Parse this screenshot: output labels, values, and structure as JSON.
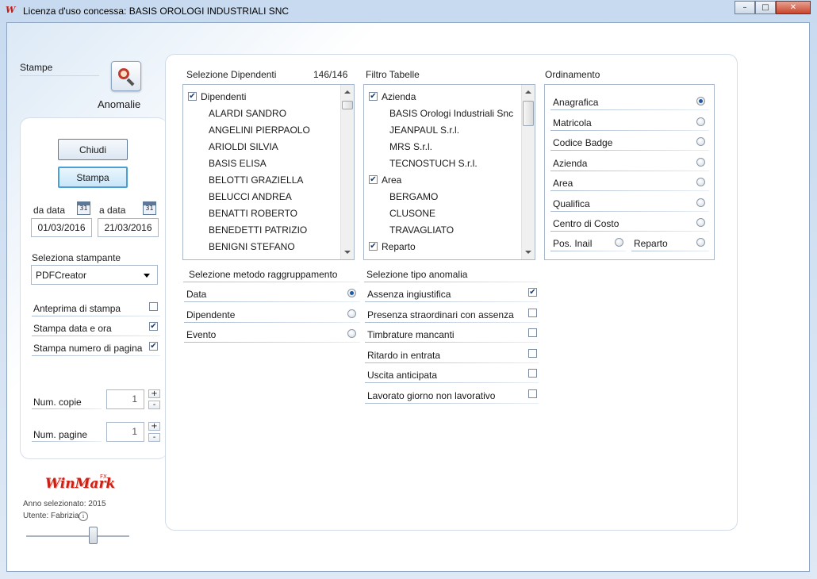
{
  "window": {
    "title": "Licenza d'uso concessa: BASIS OROLOGI INDUSTRIALI SNC",
    "logo_text": "W",
    "controls": {
      "minimize": "–",
      "maximize": "□",
      "close": "✕"
    }
  },
  "header": {
    "section_label": "Stampe",
    "report_label": "Anomalie",
    "report_icon": "magnifier-report-icon"
  },
  "left": {
    "close_label": "Chiudi",
    "print_label": "Stampa",
    "from_label": "da data",
    "to_label": "a data",
    "calendar_text": "31",
    "from_value": "01/03/2016",
    "to_value": "21/03/2016",
    "printer_label": "Seleziona stampante",
    "printer_value": "PDFCreator",
    "options": [
      {
        "label": "Anteprima di stampa",
        "checked": false
      },
      {
        "label": "Stampa data e ora",
        "checked": true
      },
      {
        "label": "Stampa numero di pagina",
        "checked": true
      }
    ],
    "copies_label": "Num. copie",
    "copies_value": "1",
    "pages_label": "Num. pagine",
    "pages_value": "1",
    "plus": "+",
    "minus": "-"
  },
  "footer": {
    "brand": "WinMark",
    "brand_sup": "FX",
    "year_text": "Anno selezionato: 2015",
    "user_text": "Utente: Fabrizia",
    "info_glyph": "i"
  },
  "dipendenti": {
    "title": "Selezione Dipendenti",
    "count": "146/146",
    "items": [
      {
        "label": "Dipendenti",
        "checkbox": true,
        "checked": true
      },
      {
        "label": "ALARDI SANDRO"
      },
      {
        "label": "ANGELINI PIERPAOLO"
      },
      {
        "label": "ARIOLDI SILVIA"
      },
      {
        "label": "BASIS ELISA"
      },
      {
        "label": "BELOTTI GRAZIELLA"
      },
      {
        "label": "BELUCCI ANDREA"
      },
      {
        "label": "BENATTI ROBERTO"
      },
      {
        "label": "BENEDETTI PATRIZIO"
      },
      {
        "label": "BENIGNI STEFANO"
      }
    ]
  },
  "filtro": {
    "title": "Filtro Tabelle",
    "items": [
      {
        "label": "Azienda",
        "checkbox": true,
        "checked": true
      },
      {
        "label": "BASIS Orologi Industriali Snc"
      },
      {
        "label": "JEANPAUL S.r.l."
      },
      {
        "label": "MRS S.r.l."
      },
      {
        "label": "TECNOSTUCH S.r.l."
      },
      {
        "label": "Area",
        "checkbox": true,
        "checked": true
      },
      {
        "label": "BERGAMO"
      },
      {
        "label": "CLUSONE"
      },
      {
        "label": "TRAVAGLIATO"
      },
      {
        "label": "Reparto",
        "checkbox": true,
        "checked": true
      }
    ]
  },
  "ordinamento": {
    "title": "Ordinamento",
    "items": [
      {
        "label": "Anagrafica",
        "selected": true
      },
      {
        "label": "Matricola",
        "selected": false
      },
      {
        "label": "Codice Badge",
        "selected": false
      },
      {
        "label": "Azienda",
        "selected": false
      },
      {
        "label": "Area",
        "selected": false
      },
      {
        "label": "Qualifica",
        "selected": false
      },
      {
        "label": "Centro di Costo",
        "selected": false
      }
    ],
    "pair": [
      {
        "label": "Pos. Inail",
        "selected": false
      },
      {
        "label": "Reparto",
        "selected": false
      }
    ]
  },
  "raggruppamento": {
    "title": "Selezione metodo raggruppamento",
    "items": [
      {
        "label": "Data",
        "selected": true
      },
      {
        "label": "Dipendente",
        "selected": false
      },
      {
        "label": "Evento",
        "selected": false
      }
    ]
  },
  "anomalia": {
    "title": "Selezione tipo anomalia",
    "items": [
      {
        "label": "Assenza ingiustifica",
        "checked": true
      },
      {
        "label": "Presenza straordinari con assenza",
        "checked": false
      },
      {
        "label": "Timbrature mancanti",
        "checked": false
      },
      {
        "label": "Ritardo in entrata",
        "checked": false
      },
      {
        "label": "Uscita anticipata",
        "checked": false
      },
      {
        "label": "Lavorato giorno non lavorativo",
        "checked": false
      }
    ]
  }
}
